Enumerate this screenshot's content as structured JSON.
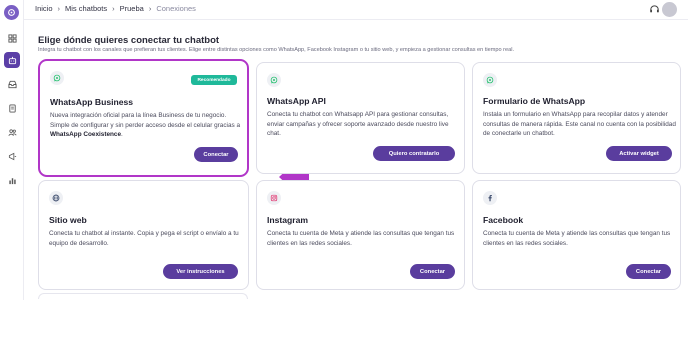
{
  "breadcrumb": [
    "Inicio",
    "Mis chatbots",
    "Prueba",
    "Conexiones"
  ],
  "header": {
    "title": "Elige dónde quieres conectar tu chatbot",
    "subtitle": "Integra tu chatbot con los canales que prefieran tus clientes. Elige entre distintas opciones como WhatsApp, Facebook Instagram o tu sitio web, y empieza a gestionar consultas en tiempo real."
  },
  "cards": [
    {
      "id": "whatsapp-business",
      "icon": "whatsapp-icon",
      "title": "WhatsApp Business",
      "badge": "Recomendado",
      "desc_pre": "Nueva integración oficial para la línea Business de tu negocio. Simple de configurar y sin perder acceso desde el celular gracias a ",
      "desc_bold": "WhatsApp Coexistence",
      "desc_post": ".",
      "button": "Conectar"
    },
    {
      "id": "whatsapp-api",
      "icon": "whatsapp-icon",
      "title": "WhatsApp API",
      "desc": "Conecta tu chatbot con Whatsapp API para gestionar consultas, enviar campañas y ofrecer soporte avanzado desde nuestro live chat.",
      "button": "Quiero contratarlo"
    },
    {
      "id": "whatsapp-form",
      "icon": "whatsapp-icon",
      "title": "Formulario de WhatsApp",
      "desc": "Instala un formulario en WhatsApp para recopilar datos y atender consultas de manera rápida. Este canal no cuenta con la posibilidad de conectarle un chatbot.",
      "button": "Activar widget"
    },
    {
      "id": "website",
      "icon": "globe-icon",
      "title": "Sitio web",
      "desc": "Conecta tu chatbot al instante. Copia y pega el script o envíalo a tu equipo de desarrollo.",
      "button": "Ver instrucciones"
    },
    {
      "id": "instagram",
      "icon": "instagram-icon",
      "title": "Instagram",
      "desc": "Conecta tu cuenta de Meta y atiende las consultas que tengan tus clientes en las redes sociales.",
      "button": "Conectar"
    },
    {
      "id": "facebook",
      "icon": "facebook-icon",
      "title": "Facebook",
      "desc": "Conecta tu cuenta de Meta y atiende las consultas que tengan tus clientes en las redes sociales.",
      "button": "Conectar"
    }
  ],
  "colors": {
    "accent": "#5a3d9e",
    "highlight": "#b136c8",
    "badge": "#1fb99a",
    "whatsapp": "#25c16f",
    "instagram": "#e1306c",
    "facebook": "#3b4a6b"
  },
  "sidebar": {
    "icons": [
      "logo-icon",
      "dashboard-icon",
      "chatbot-icon",
      "inbox-icon",
      "document-icon",
      "users-icon",
      "campaign-icon",
      "analytics-icon"
    ]
  },
  "topbar_icons": [
    "support-icon",
    "avatar"
  ]
}
